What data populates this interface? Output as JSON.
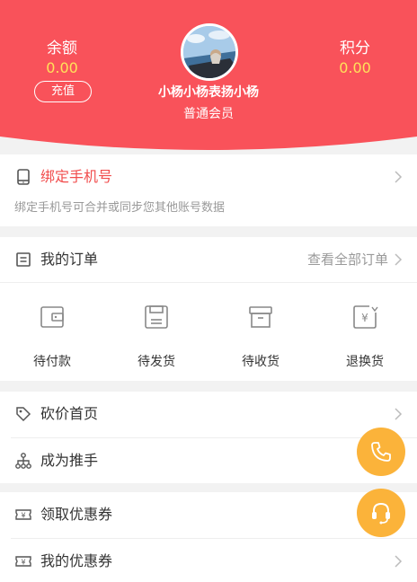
{
  "header": {
    "balance_label": "余额",
    "balance_value": "0.00",
    "recharge_label": "充值",
    "points_label": "积分",
    "points_value": "0.00",
    "username": "小杨小杨表扬小杨",
    "member_level": "普通会员",
    "bg_color": "#f9525a",
    "value_color": "#ffe25a"
  },
  "bind_phone": {
    "title": "绑定手机号",
    "description": "绑定手机号可合并或同步您其他账号数据",
    "title_color": "#f14d4d",
    "icon": "phone-icon"
  },
  "orders": {
    "title": "我的订单",
    "view_all": "查看全部订单",
    "items": [
      {
        "label": "待付款",
        "icon": "wallet-icon"
      },
      {
        "label": "待发货",
        "icon": "package-save-icon"
      },
      {
        "label": "待收货",
        "icon": "box-icon"
      },
      {
        "label": "退换货",
        "icon": "refund-icon"
      }
    ]
  },
  "menu": {
    "bargain": "砍价首页",
    "promoter": "成为推手",
    "get_coupons": "领取优惠券",
    "my_coupons": "我的优惠券"
  },
  "fab": {
    "phone": "phone-call-icon",
    "service": "headset-icon",
    "color": "#fbb33a"
  }
}
